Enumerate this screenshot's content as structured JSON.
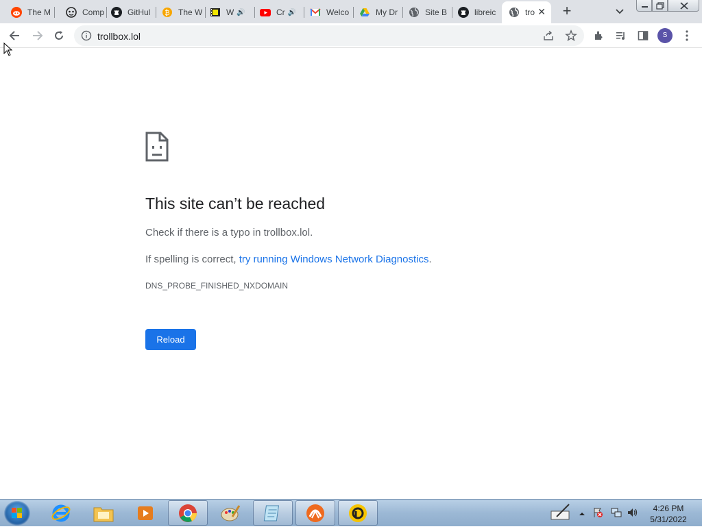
{
  "tabs": [
    {
      "title": "The M",
      "icon": "reddit-icon",
      "audio": false
    },
    {
      "title": "Comp",
      "icon": "site-mask-icon",
      "audio": false
    },
    {
      "title": "GitHul",
      "icon": "github-icon",
      "audio": false
    },
    {
      "title": "The W",
      "icon": "bitcoin-icon",
      "audio": false
    },
    {
      "title": "W",
      "icon": "film-icon",
      "audio": true
    },
    {
      "title": "Cr",
      "icon": "youtube-icon",
      "audio": true
    },
    {
      "title": "Welco",
      "icon": "gmail-icon",
      "audio": false
    },
    {
      "title": "My Dr",
      "icon": "google-drive-icon",
      "audio": false
    },
    {
      "title": "Site B",
      "icon": "globe-icon",
      "audio": false
    },
    {
      "title": "libreic",
      "icon": "github-icon",
      "audio": false
    },
    {
      "title": "tro",
      "icon": "globe-icon",
      "audio": false,
      "active": true
    }
  ],
  "address_bar": {
    "url": "trollbox.lol"
  },
  "profile": {
    "initial": "S",
    "color": "#5a53a8"
  },
  "error_page": {
    "title": "This site can’t be reached",
    "line1": "Check if there is a typo in trollbox.lol.",
    "line2_prefix": "If spelling is correct, ",
    "line2_link": "try running Windows Network Diagnostics",
    "line2_suffix": ".",
    "code": "DNS_PROBE_FINISHED_NXDOMAIN",
    "reload_label": "Reload"
  },
  "colors": {
    "accent": "#1a73e8",
    "tabstrip": "#dee1e6",
    "text_secondary": "#5f6368"
  },
  "taskbar": {
    "items": [
      "internet-explorer-icon",
      "file-explorer-icon",
      "media-player-icon",
      "chrome-icon",
      "paint-icon",
      "notepad-icon",
      "app-orange-icon",
      "app-yellow-icon"
    ],
    "clock_time": "4:26 PM",
    "clock_date": "5/31/2022"
  }
}
